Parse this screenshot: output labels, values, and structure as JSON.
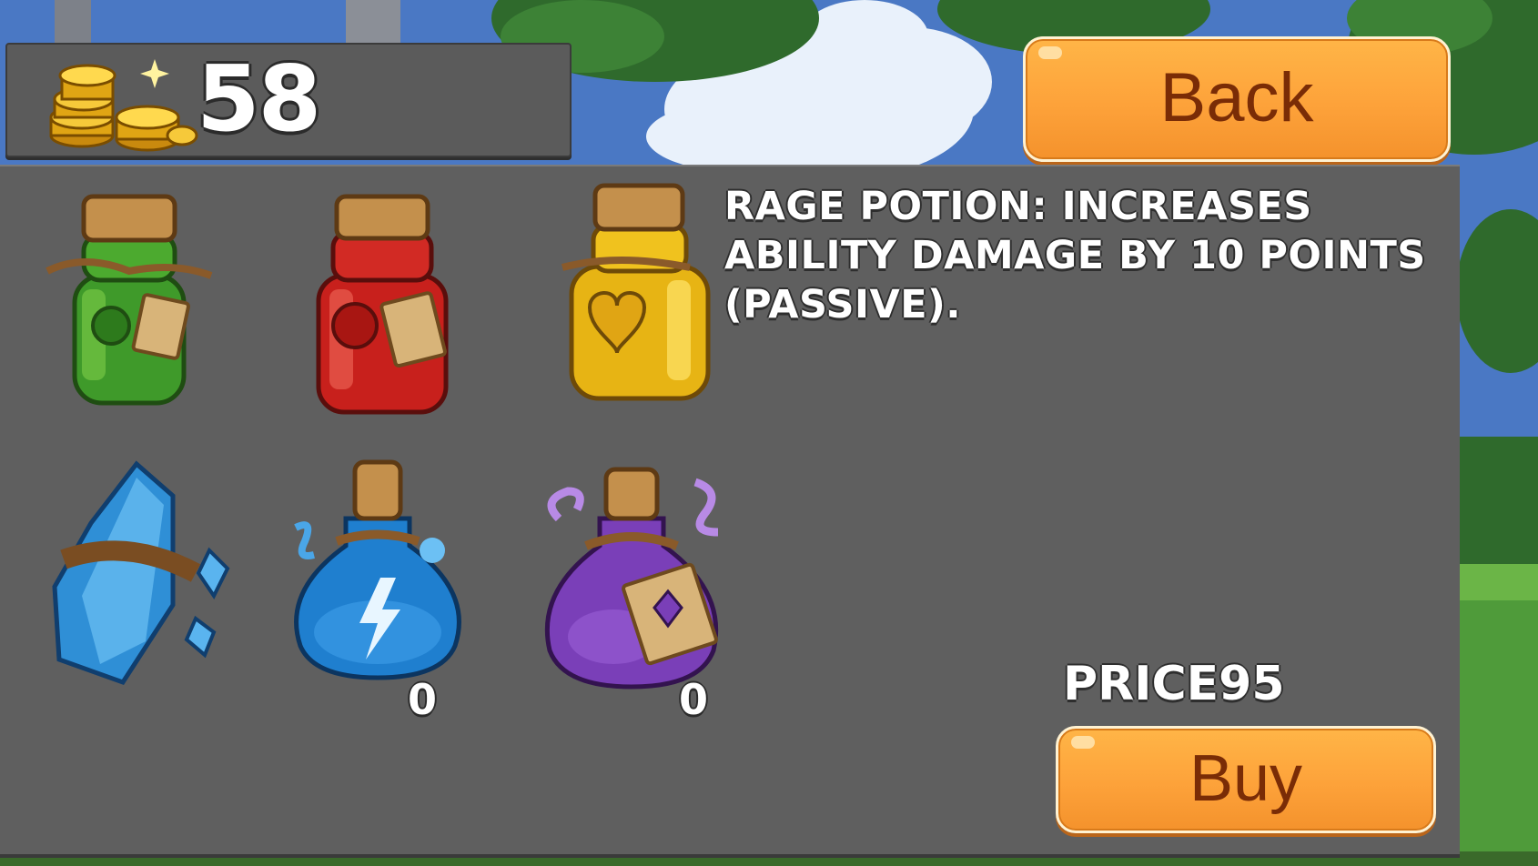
{
  "hud": {
    "coins": "58",
    "coin_icon": "gold-coins-icon"
  },
  "back_button": {
    "label": "Back"
  },
  "shop": {
    "items": [
      {
        "name": "green-potion",
        "icon": "green-potion-icon",
        "color": "#3f9a2a"
      },
      {
        "name": "red-potion",
        "icon": "red-potion-icon",
        "color": "#c8201c"
      },
      {
        "name": "rage-potion",
        "icon": "yellow-potion-icon",
        "color": "#e7b414"
      },
      {
        "name": "ice-crystal",
        "icon": "ice-crystal-icon",
        "color": "#2f8fd6"
      },
      {
        "name": "mana-potion",
        "icon": "blue-lightning-potion-icon",
        "color": "#1f7fcf",
        "quantity": "0"
      },
      {
        "name": "purple-potion",
        "icon": "purple-potion-icon",
        "color": "#7a3fb8",
        "quantity": "0"
      }
    ],
    "description": "RAGE POTION: INCREASES ABILITY DAMAGE BY 10 POINTS (PASSIVE).",
    "price_text": "PRICE95",
    "buy_label": "Buy"
  },
  "colors": {
    "panel": "#5f5f5f",
    "button": "#fda23a",
    "button_text": "#7a2c06",
    "sky": "#3f6fb8"
  }
}
